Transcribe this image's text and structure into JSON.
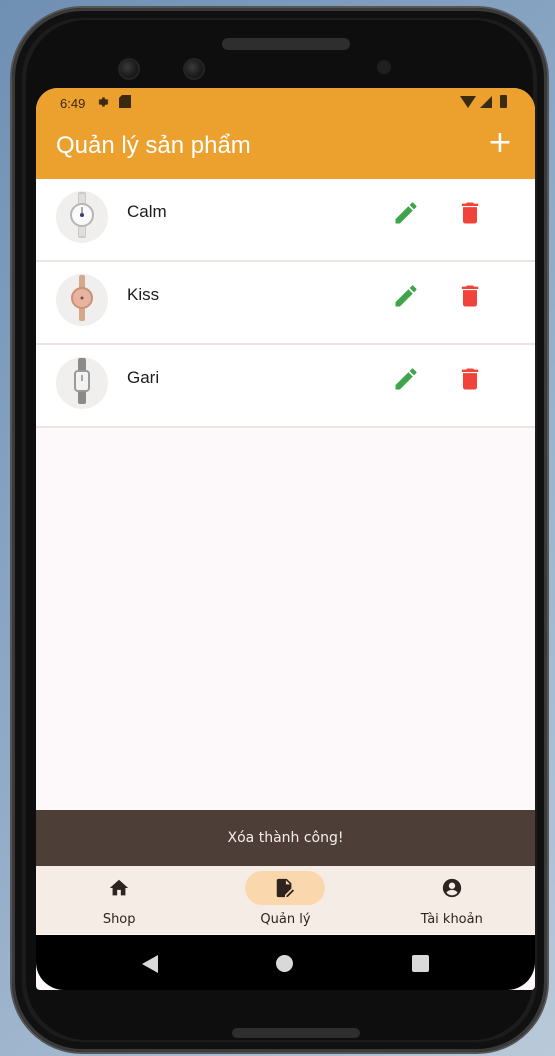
{
  "status_bar": {
    "time": "6:49",
    "icons": [
      "gear-icon",
      "sd-card-icon",
      "wifi-icon",
      "signal-icon",
      "battery-icon"
    ]
  },
  "app_bar": {
    "title": "Quản lý sản phẩm",
    "add_label": "+",
    "background": "#eca02e"
  },
  "products": [
    {
      "name": "Calm",
      "thumbnail": "watch-silver-icon"
    },
    {
      "name": "Kiss",
      "thumbnail": "watch-rose-gold-icon"
    },
    {
      "name": "Gari",
      "thumbnail": "watch-square-icon"
    }
  ],
  "actions": {
    "edit_icon": "pencil-icon",
    "delete_icon": "trash-icon",
    "edit_color": "#3ea54a",
    "delete_color": "#f0433a"
  },
  "snackbar": {
    "message": "Xóa thành công!"
  },
  "bottom_nav": {
    "items": [
      {
        "label": "Shop",
        "icon": "home-icon",
        "active": false
      },
      {
        "label": "Quản lý",
        "icon": "edit-note-icon",
        "active": true
      },
      {
        "label": "Tài khoản",
        "icon": "account-circle-icon",
        "active": false
      }
    ]
  },
  "system_nav": [
    "back-icon",
    "home-icon",
    "recents-icon"
  ]
}
